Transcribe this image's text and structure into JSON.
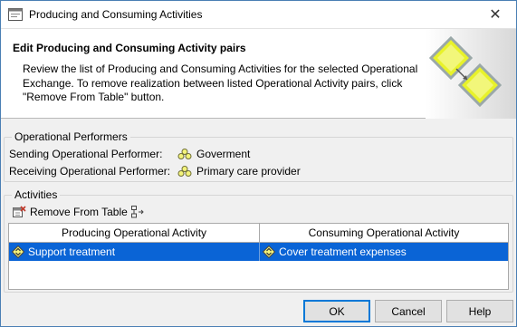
{
  "window": {
    "title": "Producing and Consuming Activities",
    "close_glyph": "✕"
  },
  "header": {
    "title": "Edit Producing and Consuming Activity pairs",
    "description": "Review the list of Producing and Consuming Activities for the selected Operational Exchange. To remove realization between listed Operational Activity pairs, click \"Remove From Table\" button."
  },
  "performers": {
    "group_label": "Operational Performers",
    "sending_label": "Sending Operational Performer:",
    "sending_value": "Goverment",
    "receiving_label": "Receiving Operational Performer:",
    "receiving_value": "Primary care provider",
    "icon": "performer-icon"
  },
  "activities": {
    "group_label": "Activities",
    "remove_label": "Remove From Table",
    "columns": [
      "Producing Operational Activity",
      "Consuming Operational Activity"
    ],
    "rows": [
      {
        "producing": "Support treatment",
        "consuming": "Cover treatment expenses",
        "selected": true
      }
    ]
  },
  "buttons": {
    "ok": "OK",
    "cancel": "Cancel",
    "help": "Help"
  },
  "colors": {
    "selection": "#0a64d6",
    "accent_green": "#e8f22a",
    "border_blue": "#4a7fb4"
  }
}
